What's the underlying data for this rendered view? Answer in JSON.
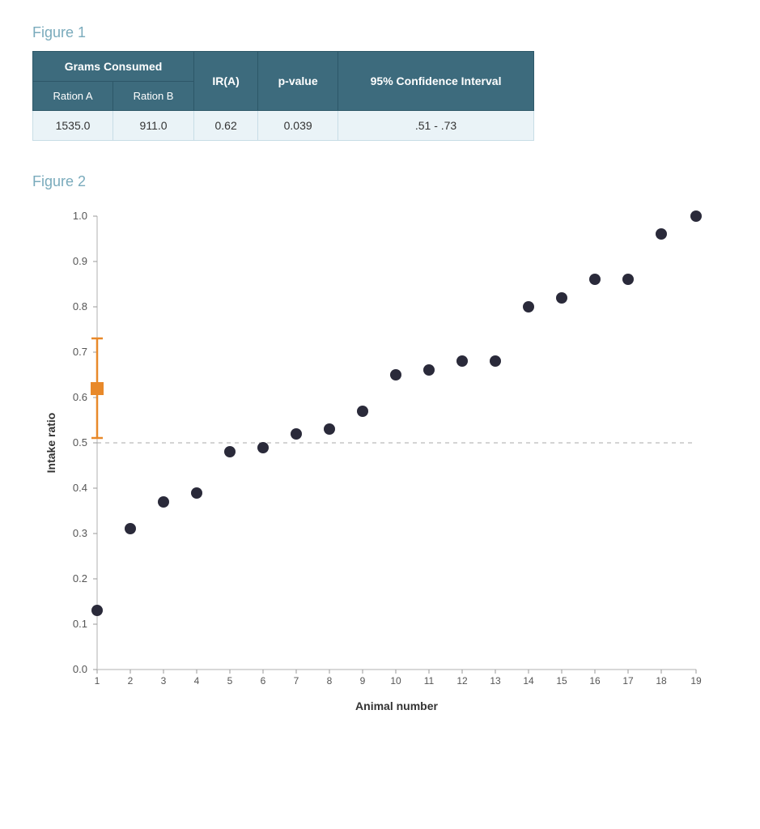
{
  "figure1": {
    "label": "Figure 1",
    "table": {
      "header_grams": "Grams Consumed",
      "header_ration_a": "Ration A",
      "header_ration_b": "Ration B",
      "header_ir": "IR(A)",
      "header_pvalue": "p-value",
      "header_ci": "95% Confidence Interval",
      "row": {
        "ration_a": "1535.0",
        "ration_b": "911.0",
        "ir": "0.62",
        "pvalue": "0.039",
        "ci": ".51 - .73"
      }
    }
  },
  "figure2": {
    "label": "Figure 2",
    "y_axis_label": "Intake ratio",
    "x_axis_label": "Animal number",
    "y_ticks": [
      "0.0",
      "0.1",
      "0.2",
      "0.3",
      "0.4",
      "0.5",
      "0.6",
      "0.7",
      "0.8",
      "0.9",
      "1.0"
    ],
    "x_ticks": [
      "1",
      "2",
      "3",
      "4",
      "5",
      "6",
      "7",
      "8",
      "9",
      "10",
      "11",
      "12",
      "13",
      "14",
      "15",
      "16",
      "17",
      "18",
      "19"
    ],
    "data_points": [
      {
        "animal": 1,
        "ratio": 0.13
      },
      {
        "animal": 2,
        "ratio": 0.31
      },
      {
        "animal": 3,
        "ratio": 0.37
      },
      {
        "animal": 4,
        "ratio": 0.39
      },
      {
        "animal": 5,
        "ratio": 0.48
      },
      {
        "animal": 6,
        "ratio": 0.49
      },
      {
        "animal": 7,
        "ratio": 0.52
      },
      {
        "animal": 8,
        "ratio": 0.53
      },
      {
        "animal": 9,
        "ratio": 0.57
      },
      {
        "animal": 10,
        "ratio": 0.65
      },
      {
        "animal": 11,
        "ratio": 0.66
      },
      {
        "animal": 12,
        "ratio": 0.68
      },
      {
        "animal": 13,
        "ratio": 0.68
      },
      {
        "animal": 14,
        "ratio": 0.8
      },
      {
        "animal": 15,
        "ratio": 0.82
      },
      {
        "animal": 16,
        "ratio": 0.86
      },
      {
        "animal": 17,
        "ratio": 0.86
      },
      {
        "animal": 18,
        "ratio": 0.96
      },
      {
        "animal": 19,
        "ratio": 1.0
      }
    ],
    "mean_point": {
      "animal": 1,
      "ratio": 0.62
    },
    "ci_low": 0.51,
    "ci_high": 0.73,
    "mean_color": "#e8892a"
  }
}
